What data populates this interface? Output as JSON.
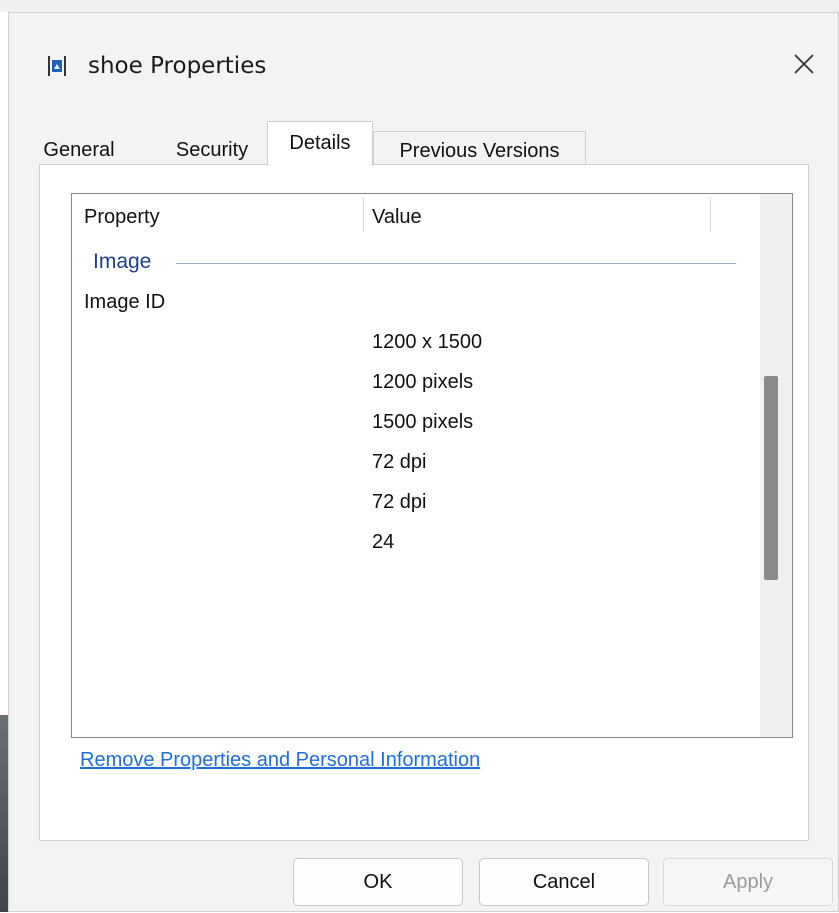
{
  "window": {
    "title": "shoe Properties",
    "icon": "image-file-icon",
    "close_icon": "close-icon"
  },
  "tabs": [
    {
      "label": "General",
      "active": false
    },
    {
      "label": "Security",
      "active": false
    },
    {
      "label": "Details",
      "active": true
    },
    {
      "label": "Previous Versions",
      "active": false
    }
  ],
  "details": {
    "headers": {
      "property": "Property",
      "value": "Value"
    },
    "group": "Image",
    "rows": [
      {
        "property": "Image ID",
        "value": ""
      },
      {
        "property": "",
        "value": "1200 x 1500"
      },
      {
        "property": "",
        "value": "1200 pixels"
      },
      {
        "property": "",
        "value": "1500 pixels"
      },
      {
        "property": "",
        "value": "72 dpi"
      },
      {
        "property": "",
        "value": "72 dpi"
      },
      {
        "property": "",
        "value": "24"
      }
    ]
  },
  "remove_link": "Remove Properties and Personal Information",
  "buttons": {
    "ok": "OK",
    "cancel": "Cancel",
    "apply": "Apply"
  },
  "colors": {
    "link": "#1e6fd9",
    "group_heading": "#1f3f8a",
    "dialog_bg": "#f3f3f3"
  }
}
